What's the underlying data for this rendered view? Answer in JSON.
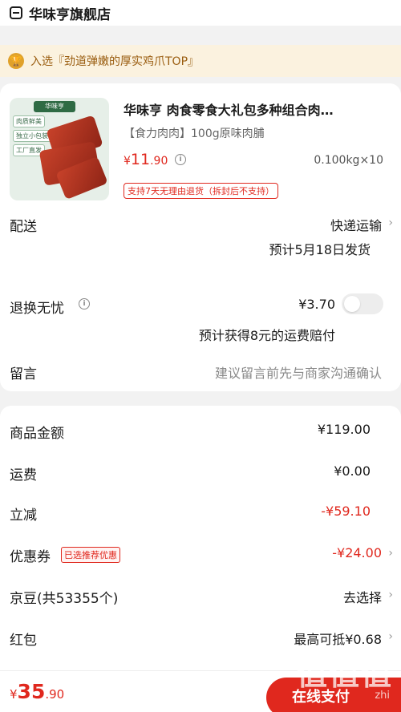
{
  "store": {
    "name": "华味亨旗舰店"
  },
  "banner": {
    "text": "入选『劲道弹嫩的厚实鸡爪TOP』"
  },
  "product": {
    "title": "华味亨 肉食零食大礼包多种组合肉…",
    "spec": "【食力肉肉】100g原味肉脯",
    "price_symbol": "¥",
    "price_int": "11",
    "price_dec": ".90",
    "quantity": "0.100kg×10",
    "return_policy": "支持7天无理由退货（拆封后不支持）",
    "image_tags": [
      "肉质鲜美",
      "独立小包装",
      "工厂直发"
    ]
  },
  "delivery": {
    "label": "配送",
    "method": "快递运输",
    "eta": "预计5月18日发货"
  },
  "return_insurance": {
    "label": "退换无忧",
    "price": "¥3.70",
    "note": "预计获得8元的运费赔付"
  },
  "message": {
    "label": "留言",
    "placeholder": "建议留言前先与商家沟通确认"
  },
  "summary": {
    "goods_label": "商品金额",
    "goods_value": "¥119.00",
    "shipping_label": "运费",
    "shipping_value": "¥0.00",
    "discount_label": "立减",
    "discount_value": "-¥59.10",
    "coupon_label": "优惠券",
    "coupon_tag": "已选推荐优惠",
    "coupon_value": "-¥24.00",
    "jingdou_label": "京豆(共53355个)",
    "jingdou_value": "去选择",
    "redpacket_label": "红包",
    "redpacket_value": "最高可抵¥0.68"
  },
  "footer": {
    "total_symbol": "¥",
    "total_int": "35",
    "total_dec": ".90",
    "pay_label": "在线支付"
  },
  "watermark": {
    "text": "值值值",
    "sub": "zhi"
  },
  "colors": {
    "accent": "#e0281e",
    "banner_bg": "#fbf2df",
    "banner_text": "#9a5d10"
  }
}
